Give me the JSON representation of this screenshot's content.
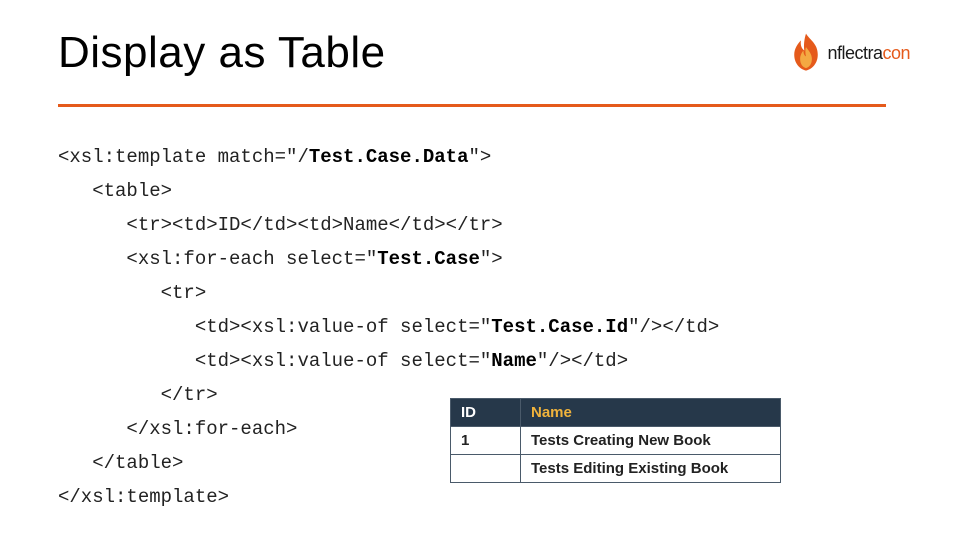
{
  "title": "Display as Table",
  "logo": {
    "text_dark": "nflectra",
    "text_orange": "con"
  },
  "code_lines": [
    {
      "indent": 0,
      "segments": [
        {
          "t": "<xsl:template match=\"/"
        },
        {
          "t": "Test.Case.Data",
          "b": true
        },
        {
          "t": "\">"
        }
      ]
    },
    {
      "indent": 1,
      "segments": [
        {
          "t": "<table>"
        }
      ]
    },
    {
      "indent": 2,
      "segments": [
        {
          "t": "<tr><td>ID</td><td>Name</td></tr>"
        }
      ]
    },
    {
      "indent": 2,
      "segments": [
        {
          "t": "<xsl:for-each select=\""
        },
        {
          "t": "Test.Case",
          "b": true
        },
        {
          "t": "\">"
        }
      ]
    },
    {
      "indent": 3,
      "segments": [
        {
          "t": "<tr>"
        }
      ]
    },
    {
      "indent": 4,
      "segments": [
        {
          "t": "<td><xsl:value-of select=\""
        },
        {
          "t": "Test.Case.Id",
          "b": true
        },
        {
          "t": "\"/></td>"
        }
      ]
    },
    {
      "indent": 4,
      "segments": [
        {
          "t": "<td><xsl:value-of select=\""
        },
        {
          "t": "Name",
          "b": true
        },
        {
          "t": "\"/></td>"
        }
      ]
    },
    {
      "indent": 3,
      "segments": [
        {
          "t": "</tr>"
        }
      ]
    },
    {
      "indent": 2,
      "segments": [
        {
          "t": "</xsl:for-each>"
        }
      ]
    },
    {
      "indent": 1,
      "segments": [
        {
          "t": "</table>"
        }
      ]
    },
    {
      "indent": 0,
      "segments": [
        {
          "t": "</xsl:template>"
        }
      ]
    }
  ],
  "table": {
    "headers": {
      "id": "ID",
      "name": "Name"
    },
    "rows": [
      {
        "id": "1",
        "name": "Tests Creating New Book"
      },
      {
        "id": "",
        "name": "Tests Editing Existing Book"
      }
    ]
  }
}
